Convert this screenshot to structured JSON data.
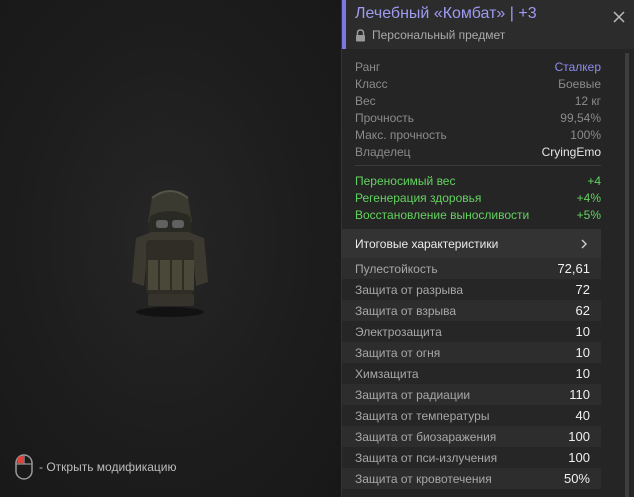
{
  "viewer": {
    "hint_text": "- Открыть модификацию"
  },
  "item": {
    "title": "Лечебный «Комбат» | +3",
    "subtitle": "Персональный предмет"
  },
  "info": [
    {
      "label": "Ранг",
      "value": "Сталкер"
    },
    {
      "label": "Класс",
      "value": "Боевые"
    },
    {
      "label": "Вес",
      "value": "12 кг"
    },
    {
      "label": "Прочность",
      "value": "99,54%"
    },
    {
      "label": "Макс. прочность",
      "value": "100%"
    },
    {
      "label": "Владелец",
      "value": "CryingEmo"
    }
  ],
  "bonuses": [
    {
      "label": "Переносимый вес",
      "value": "+4"
    },
    {
      "label": "Регенерация здоровья",
      "value": "+4%"
    },
    {
      "label": "Восстановление выносливости",
      "value": "+5%"
    }
  ],
  "summary_label": "Итоговые характеристики",
  "stats": [
    {
      "label": "Пулестойкость",
      "value": "72,61"
    },
    {
      "label": "Защита от разрыва",
      "value": "72"
    },
    {
      "label": "Защита от взрыва",
      "value": "62"
    },
    {
      "label": "Электрозащита",
      "value": "10"
    },
    {
      "label": "Защита от огня",
      "value": "10"
    },
    {
      "label": "Химзащита",
      "value": "10"
    },
    {
      "label": "Защита от радиации",
      "value": "110"
    },
    {
      "label": "Защита от температуры",
      "value": "40"
    },
    {
      "label": "Защита от биозаражения",
      "value": "100"
    },
    {
      "label": "Защита от пси-излучения",
      "value": "100"
    },
    {
      "label": "Защита от кровотечения",
      "value": "50%"
    }
  ],
  "colors": {
    "accent": "#7b78e6",
    "bonus": "#63d35f"
  }
}
